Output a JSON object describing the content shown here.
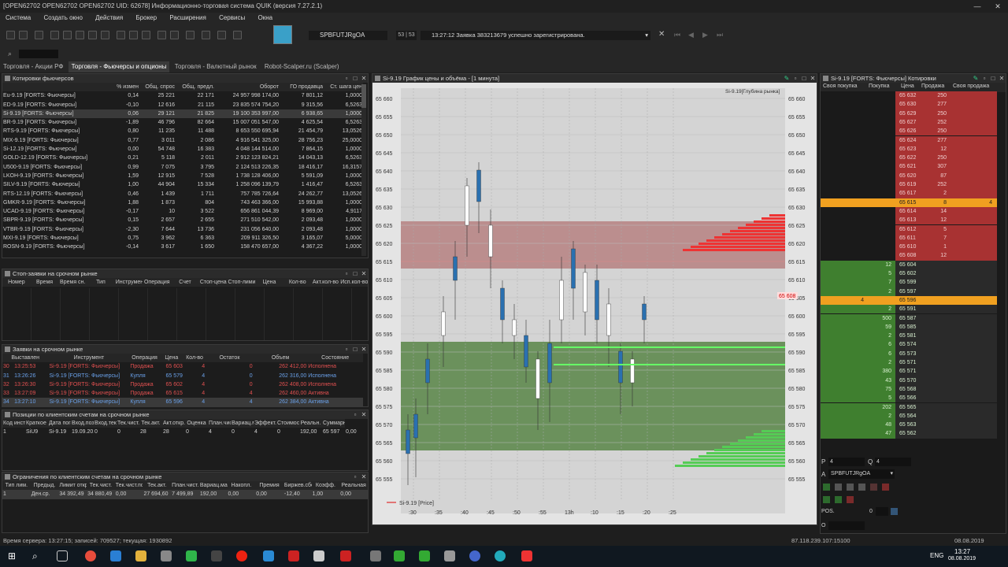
{
  "window": {
    "title": "[OPEN62702 OPEN62702 OPEN62702 UID: 62678] Информационно-торговая система QUIK (версия 7.27.2.1)"
  },
  "menu": [
    "Система",
    "Создать окно",
    "Действия",
    "Брокер",
    "Расширения",
    "Сервисы",
    "Окна"
  ],
  "toolbar": {
    "account": "SPBFUTJRgOA",
    "counter": "53 | 53",
    "message": "13:27:12  Заявка 383213679 успешно зарегистрирована."
  },
  "tabs": [
    "Торговля - Акции РФ",
    "Торговля - Фьючерсы и опционы",
    "Торговля - Валютный рынок",
    "Robot-Scalper.ru (Scalper)"
  ],
  "futures": {
    "title": "Котировки фьючерсов",
    "columns": [
      "",
      "% измен",
      "Общ. спрос",
      "Общ. предл.",
      "Оборот",
      "ГО продавца",
      "Ст. шага цен"
    ],
    "rows": [
      [
        "Eu-9.19 [FORTS: Фьючерсы]",
        "0,14",
        "25 221",
        "22 171",
        "24 957 998 174,00",
        "7 801,12",
        "1,0000"
      ],
      [
        "ED-9.19 [FORTS: Фьючерсы]",
        "-0,10",
        "12 616",
        "21 115",
        "23 835 574 754,20",
        "9 315,56",
        "6,5263"
      ],
      [
        "Si-9.19 [FORTS: Фьючерсы]",
        "0,06",
        "29 121",
        "21 825",
        "19 100 353 997,00",
        "6 938,65",
        "1,0000"
      ],
      [
        "BR-9.19 [FORTS: Фьючерсы]",
        "-1,89",
        "46 796",
        "82 664",
        "15 007 051 547,00",
        "4 625,54",
        "6,5263"
      ],
      [
        "RTS-9.19 [FORTS: Фьючерсы]",
        "0,80",
        "11 235",
        "11 488",
        "8 653 550 695,94",
        "21 454,79",
        "13,0526"
      ],
      [
        "MIX-9.19 [FORTS: Фьючерсы]",
        "0,77",
        "3 011",
        "2 086",
        "4 916 541 325,00",
        "28 756,23",
        "25,0000"
      ],
      [
        "Si-12.19 [FORTS: Фьючерсы]",
        "0,00",
        "54 748",
        "16 383",
        "4 048 144 514,00",
        "7 864,15",
        "1,0000"
      ],
      [
        "GOLD-12.19 [FORTS: Фьючерсы]",
        "0,21",
        "5 118",
        "2 011",
        "2 912 123 824,21",
        "14 043,13",
        "6,5263"
      ],
      [
        "U500-9.19 [FORTS: Фьючерсы]",
        "0,99",
        "7 075",
        "3 795",
        "2 124 513 226,35",
        "18 416,17",
        "16,3157"
      ],
      [
        "LKOH-9.19 [FORTS: Фьючерсы]",
        "1,59",
        "12 915",
        "7 528",
        "1 738 128 406,00",
        "5 591,09",
        "1,0000"
      ],
      [
        "SILV-9.19 [FORTS: Фьючерсы]",
        "1,00",
        "44 904",
        "15 334",
        "1 258 096 139,79",
        "1 416,47",
        "6,5263"
      ],
      [
        "RTS-12.19 [FORTS: Фьючерсы]",
        "0,46",
        "1 439",
        "1 711",
        "757 785 726,64",
        "24 262,77",
        "13,0526"
      ],
      [
        "GMKR-9.19 [FORTS: Фьючерсы]",
        "1,88",
        "1 873",
        "804",
        "743 463 366,00",
        "15 993,88",
        "1,0000"
      ],
      [
        "UCAD-9.19 [FORTS: Фьючерсы]",
        "-0,17",
        "10",
        "3 522",
        "656 861 044,39",
        "8 969,00",
        "4,9117"
      ],
      [
        "SBPR-9.19 [FORTS: Фьючерсы]",
        "0,15",
        "2 657",
        "2 655",
        "271 510 542,00",
        "2 093,48",
        "1,0000"
      ],
      [
        "VTBR-9.19 [FORTS: Фьючерсы]",
        "-2,30",
        "7 644",
        "13 736",
        "231 056 640,00",
        "2 093,48",
        "1,0000"
      ],
      [
        "MXI-9.19 [FORTS: Фьючерсы]",
        "0,75",
        "3 962",
        "6 363",
        "209 911 326,50",
        "3 165,07",
        "5,0000"
      ],
      [
        "ROSN-9.19 [FORTS: Фьючерсы]",
        "-0,14",
        "3 617",
        "1 650",
        "158 470 657,00",
        "4 367,22",
        "1,0000"
      ]
    ]
  },
  "stop_orders": {
    "title": "Стоп-заявки на срочном рынке",
    "columns": [
      "Номер",
      "Время",
      "Время сн.",
      "Тип",
      "Инструмент",
      "Операция",
      "Счет",
      "Стоп-цена",
      "Стоп-лимит",
      "Цена",
      "Кол-во",
      "Акт.кол-во",
      "Исп.кол-во"
    ]
  },
  "orders": {
    "title": "Заявки на срочном рынке",
    "columns": [
      "Выставлен",
      "Инструмент",
      "Операция",
      "Цена",
      "Кол-во",
      "Остаток",
      "Объем",
      "Состояние"
    ],
    "rows": [
      [
        "30",
        "13:25:53",
        "Si-9.19 [FORTS: Фьючерсы]",
        "Продажа",
        "65 603",
        "4",
        "0",
        "262 412,00",
        "Исполнена"
      ],
      [
        "31",
        "13:26:26",
        "Si-9.19 [FORTS: Фьючерсы]",
        "Купля",
        "65 579",
        "4",
        "0",
        "262 316,00",
        "Исполнена"
      ],
      [
        "32",
        "13:26:30",
        "Si-9.19 [FORTS: Фьючерсы]",
        "Продажа",
        "65 602",
        "4",
        "0",
        "262 408,00",
        "Исполнена"
      ],
      [
        "33",
        "13:27:09",
        "Si-9.19 [FORTS: Фьючерсы]",
        "Продажа",
        "65 615",
        "4",
        "4",
        "262 460,00",
        "Активна"
      ],
      [
        "34",
        "13:27:10",
        "Si-9.19 [FORTS: Фьючерсы]",
        "Купля",
        "65 596",
        "4",
        "4",
        "262 384,00",
        "Активна"
      ]
    ]
  },
  "positions": {
    "title": "Позиции по клиентским счетам на срочном рынке",
    "columns": [
      "Код инст.",
      "Краткое наим.",
      "Дата погаш.",
      "Вход.поз.",
      "Вход.тек.",
      "Тек.чист.",
      "Тек.акт.",
      "Акт.откр.",
      "Оценка",
      "План.чист.",
      "Вариац.маржа",
      "Эффект.цена",
      "Стоимость",
      "Реальн.",
      "Суммарн."
    ],
    "row": [
      "1",
      "SiU9",
      "Si-9.19",
      "19.09.2019",
      "0",
      "0",
      "28",
      "28",
      "0",
      "4",
      "0",
      "4",
      "0",
      "192,00",
      "65 597",
      "0,00"
    ]
  },
  "limits": {
    "title": "Ограничения по клиентским счетам на срочном рынке",
    "columns": [
      "Тип лим.",
      "Предыд.",
      "Лимит откр.",
      "Тек.чист.",
      "Тек.чист.поз.",
      "Тек.акт.",
      "План.чист.",
      "Вариац.маржа",
      "Накопл.",
      "Премия",
      "Биржев.сбор",
      "Коэфф.",
      "Реальная"
    ],
    "row": [
      "1",
      "Ден.ср.",
      "34 392,49",
      "34 880,49",
      "0,00",
      "27 694,60",
      "7 499,89",
      "192,00",
      "0,00",
      "0,00",
      "-12,40",
      "1,00",
      "0,00"
    ]
  },
  "chart": {
    "title": "Si-9.19 График цены и объёма - [1 минута]",
    "depth_label": "Si-9.19[Глубина рынка]",
    "legend": "Si-9.19 [Price]",
    "price_labels": [
      "65 660",
      "65 655",
      "65 650",
      "65 645",
      "65 640",
      "65 635",
      "65 630",
      "65 625",
      "65 620",
      "65 615",
      "65 610",
      "65 605",
      "65 600",
      "65 595",
      "65 590",
      "65 585",
      "65 580",
      "65 575",
      "65 570",
      "65 565",
      "65 560",
      "65 555"
    ],
    "current_price": "65 608",
    "time_labels": [
      ":30",
      ":35",
      ":40",
      ":45",
      ":50",
      ":55",
      "13h",
      ":10",
      ":15",
      ":20",
      ":25"
    ]
  },
  "orderbook": {
    "title": "Si-9.19 [FORTS: Фьючерсы] Котировки",
    "columns": [
      "Своя покупка",
      "Покупка",
      "Цена",
      "Продажа",
      "Своя продажа"
    ],
    "asks": [
      [
        "65 632",
        "250"
      ],
      [
        "65 630",
        "277"
      ],
      [
        "65 629",
        "250"
      ],
      [
        "65 627",
        "252"
      ],
      [
        "65 626",
        "250"
      ],
      [
        "65 624",
        "277"
      ],
      [
        "65 623",
        "12"
      ],
      [
        "65 622",
        "250"
      ],
      [
        "65 621",
        "307"
      ],
      [
        "65 620",
        "87"
      ],
      [
        "65 619",
        "252"
      ],
      [
        "65 617",
        "2"
      ]
    ],
    "own_ask": {
      "price": "65 615",
      "qty": "8",
      "own": "4"
    },
    "asks2": [
      [
        "65 614",
        "14"
      ],
      [
        "65 613",
        "12"
      ],
      [
        "65 612",
        "5"
      ],
      [
        "65 611",
        "7"
      ],
      [
        "65 610",
        "1"
      ],
      [
        "65 608",
        "12"
      ]
    ],
    "bids1": [
      [
        "12",
        "65 604"
      ],
      [
        "5",
        "65 602"
      ],
      [
        "7",
        "65 599"
      ],
      [
        "2",
        "65 597"
      ]
    ],
    "own_bid": {
      "own": "4",
      "price": "65 596"
    },
    "bids": [
      [
        "2",
        "65 591"
      ],
      [
        "500",
        "65 587"
      ],
      [
        "59",
        "65 585"
      ],
      [
        "2",
        "65 581"
      ],
      [
        "6",
        "65 574"
      ],
      [
        "6",
        "65 573"
      ],
      [
        "2",
        "65 571"
      ],
      [
        "380",
        "65 571"
      ],
      [
        "43",
        "65 570"
      ],
      [
        "75",
        "65 568"
      ],
      [
        "5",
        "65 566"
      ],
      [
        "202",
        "65 565"
      ],
      [
        "2",
        "65 564"
      ],
      [
        "48",
        "65 563"
      ],
      [
        "47",
        "65 562"
      ]
    ],
    "p_label": "P",
    "p_value": "4",
    "q_label": "Q",
    "q_value": "4",
    "account_label": "A",
    "account": "SPBFUTJRgOA",
    "pos_label": "POS.",
    "pos_value": "0",
    "o_label": "O"
  },
  "status": {
    "left": "Время сервера: 13:27:15; записей: 709527; текущая: 1930892",
    "right": "87.118.239.107:15100",
    "date": "08.08.2019"
  },
  "taskbar": {
    "lang": "ENG",
    "time": "13:27",
    "date": "08.08.2019"
  },
  "colors": {
    "ask": "#a83232",
    "bid": "#3f7f2f",
    "highlight": "#f0a020"
  }
}
